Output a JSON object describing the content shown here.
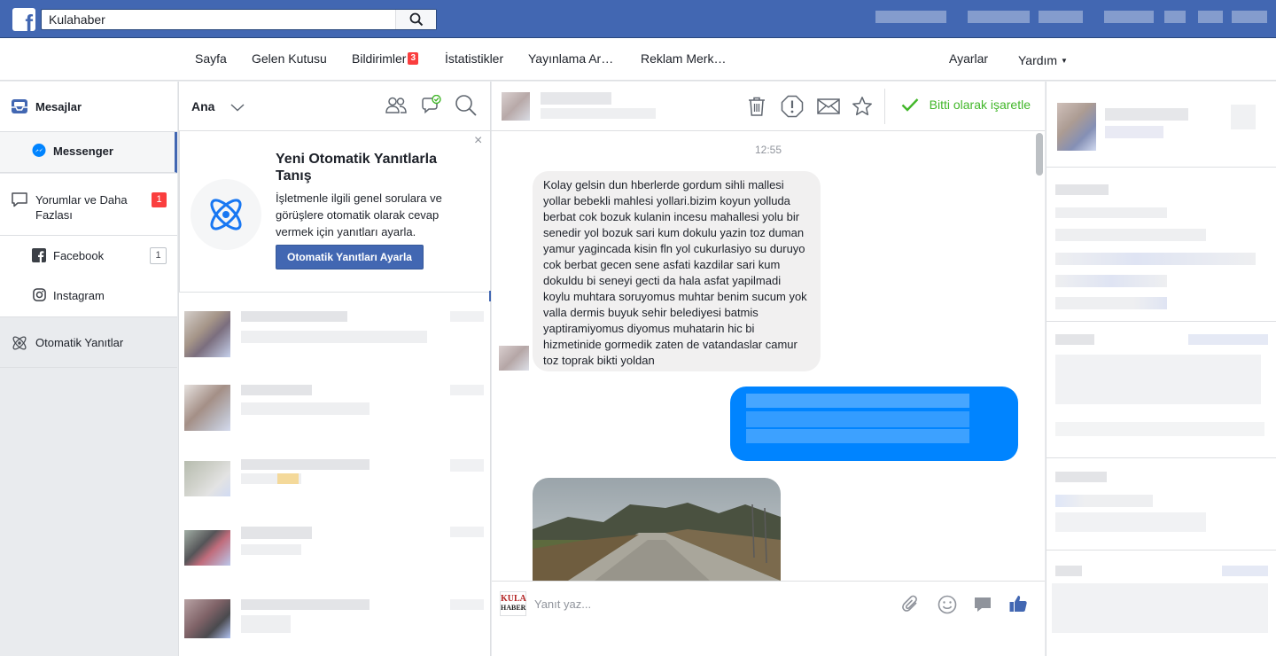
{
  "topbar": {
    "logo": "f",
    "search_value": "Kulahaber"
  },
  "nav": {
    "sayfa": "Sayfa",
    "gelen_kutusu": "Gelen Kutusu",
    "bildirimler": "Bildirimler",
    "bildirimler_count": "3",
    "istatistikler": "İstatistikler",
    "yayinlama": "Yayınlama Ar…",
    "reklam": "Reklam Merk…",
    "ayarlar": "Ayarlar",
    "yardim": "Yardım"
  },
  "sidebar": {
    "mesajlar": "Mesajlar",
    "messenger": "Messenger",
    "yorumlar": "Yorumlar ve Daha Fazlası",
    "yorumlar_count": "1",
    "facebook": "Facebook",
    "facebook_count": "1",
    "instagram": "Instagram",
    "otomatik": "Otomatik Yanıtlar"
  },
  "conversations": {
    "filter_label": "Ana",
    "promo": {
      "title": "Yeni Otomatik Yanıtlarla Tanış",
      "body": "İşletmenle ilgili genel sorulara ve görüşlere otomatik olarak cevap vermek için yanıtları ayarla.",
      "button": "Otomatik Yanıtları Ayarla",
      "close": "×"
    }
  },
  "chat": {
    "header": {
      "mark_done": "Bitti olarak işaretle"
    },
    "timestamp": "12:55",
    "incoming_message": "Kolay gelsin dun hberlerde gordum sihli mallesi yollar bebekli mahlesi yollari.bizim koyun yolluda berbat cok bozuk kulanin incesu mahallesi yolu bir senedir yol bozuk sari kum dokulu yazin toz duman yamur yagincada kisin fln yol cukurlasiyo su duruyo cok berbat gecen sene asfati kazdilar sari kum dokuldu bi seneyi gecti da hala asfat yapilmadi koylu muhtara soruyomus muhtar benim sucum yok valla dermis buyuk sehir belediyesi batmis yaptiramiyomus diyomus muhatarin hic bi hizmetinide gormedik zaten de vatandaslar camur toz toprak bikti yoldan",
    "composer": {
      "placeholder": "Yanıt yaz...",
      "page_logo_top": "KULA",
      "page_logo_bottom": "HABER"
    }
  },
  "colors": {
    "brand": "#4267b2",
    "messenger_blue": "#0084ff",
    "done_green": "#42b72a",
    "badge_red": "#fa3e3e"
  }
}
